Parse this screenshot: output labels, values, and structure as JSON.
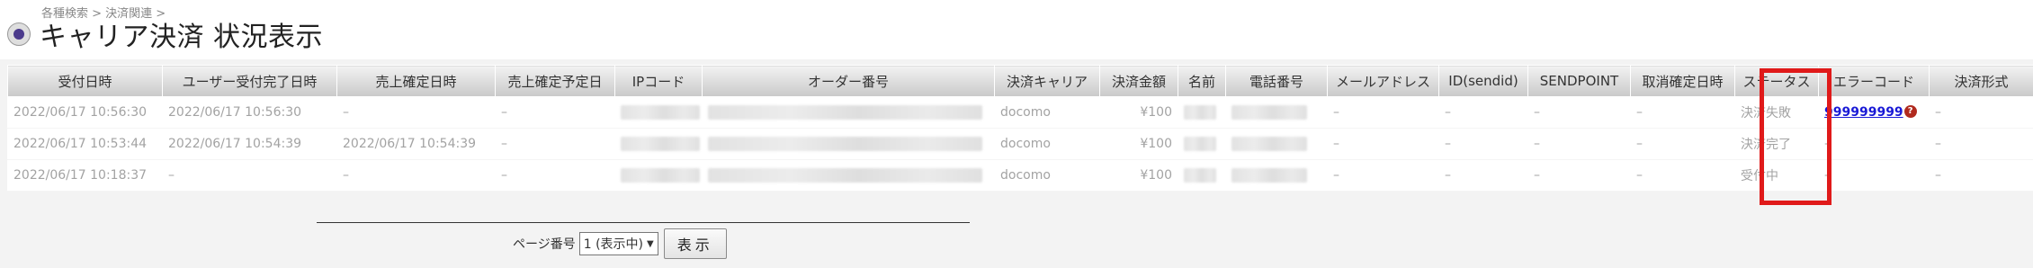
{
  "header": {
    "breadcrumb": "各種検索 > 決済関連 >",
    "title": "キャリア決済 状況表示"
  },
  "table": {
    "columns": [
      "受付日時",
      "ユーザー受付完了日時",
      "売上確定日時",
      "売上確定予定日",
      "IPコード",
      "オーダー番号",
      "決済キャリア",
      "決済金額",
      "名前",
      "電話番号",
      "メールアドレス",
      "ID(sendid)",
      "SENDPOINT",
      "取消確定日時",
      "ステータス",
      "エラーコード",
      "決済形式"
    ],
    "rows": [
      {
        "received": "2022/06/17 10:56:30",
        "user_completed": "2022/06/17 10:56:30",
        "sales_confirmed": "–",
        "sales_scheduled": "–",
        "carrier": "docomo",
        "amount": "¥100",
        "email": "–",
        "sendid": "–",
        "sendpoint": "–",
        "cancel_confirmed": "–",
        "status": "決済失敗",
        "error_code": "999999999",
        "payment_type": "–"
      },
      {
        "received": "2022/06/17 10:53:44",
        "user_completed": "2022/06/17 10:54:39",
        "sales_confirmed": "2022/06/17 10:54:39",
        "sales_scheduled": "–",
        "carrier": "docomo",
        "amount": "¥100",
        "email": "–",
        "sendid": "–",
        "sendpoint": "–",
        "cancel_confirmed": "–",
        "status": "決済完了",
        "error_code": "–",
        "payment_type": "–"
      },
      {
        "received": "2022/06/17 10:18:37",
        "user_completed": "–",
        "sales_confirmed": "–",
        "sales_scheduled": "–",
        "carrier": "docomo",
        "amount": "¥100",
        "email": "–",
        "sendid": "–",
        "sendpoint": "–",
        "cancel_confirmed": "–",
        "status": "受付中",
        "error_code": "–",
        "payment_type": "–"
      }
    ]
  },
  "pager": {
    "label": "ページ番号",
    "selected": "1 (表示中)",
    "button": "表示"
  },
  "colors": {
    "highlight": "#e01a1a",
    "link": "#1a1ad6"
  }
}
